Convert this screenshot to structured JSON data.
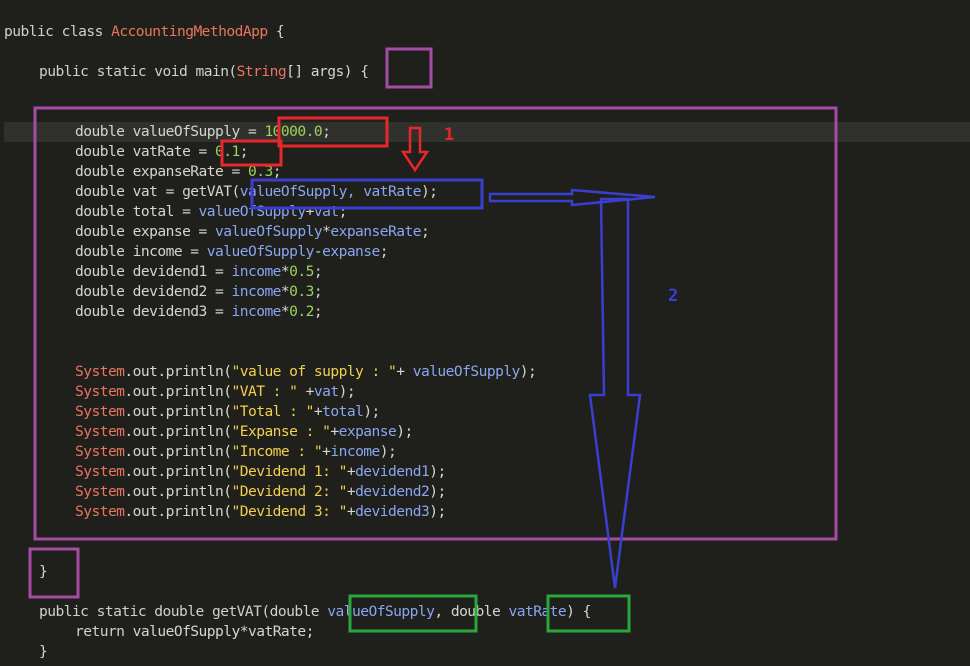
{
  "code": {
    "l1": [
      "public class ",
      "AccountingMethodApp",
      " {"
    ],
    "l2": [
      "public static void main(",
      "String",
      "[] args) {"
    ],
    "l3": [
      "double valueOfSupply = ",
      "10000.0",
      ";"
    ],
    "l4": [
      "double vatRate = ",
      "0.1",
      ";"
    ],
    "l5": [
      "double expanseRate = ",
      "0.3",
      ";"
    ],
    "l6": [
      "double vat = getVAT(",
      "valueOfSupply, vatRate",
      ");"
    ],
    "l7": [
      "double total = ",
      "valueOfSupply",
      "+",
      "vat",
      ";"
    ],
    "l8": [
      "double expanse = ",
      "valueOfSupply",
      "*",
      "expanseRate",
      ";"
    ],
    "l9": [
      "double income = ",
      "valueOfSupply",
      "-",
      "expanse",
      ";"
    ],
    "l10": [
      "double devidend1 = ",
      "income",
      "*",
      "0.5",
      ";"
    ],
    "l11": [
      "double devidend2 = ",
      "income",
      "*",
      "0.3",
      ";"
    ],
    "l12": [
      "double devidend3 = ",
      "income",
      "*",
      "0.2",
      ";"
    ],
    "p1": [
      "System",
      ".out.println(",
      "\"value of supply : \"",
      "+ ",
      "valueOfSupply",
      ");"
    ],
    "p2": [
      "System",
      ".out.println(",
      "\"VAT : \"",
      " +",
      "vat",
      ");"
    ],
    "p3": [
      "System",
      ".out.println(",
      "\"Total : \"",
      "+",
      "total",
      ");"
    ],
    "p4": [
      "System",
      ".out.println(",
      "\"Expanse : \"",
      "+",
      "expanse",
      ");"
    ],
    "p5": [
      "System",
      ".out.println(",
      "\"Income : \"",
      "+",
      "income",
      ");"
    ],
    "p6": [
      "System",
      ".out.println(",
      "\"Devidend 1: \"",
      "+",
      "devidend1",
      ");"
    ],
    "p7": [
      "System",
      ".out.println(",
      "\"Devidend 2: \"",
      "+",
      "devidend2",
      ");"
    ],
    "p8": [
      "System",
      ".out.println(",
      "\"Devidend 3: \"",
      "+",
      "devidend3",
      ");"
    ],
    "close_main": "}",
    "m1": [
      "public static double getVAT(double ",
      "valueOfSupply",
      ", double ",
      "vatRate",
      ") {"
    ],
    "m2": [
      "return ",
      "valueOfSupply",
      "*",
      "vatRate",
      ";"
    ],
    "m3": "}"
  },
  "annotations": {
    "label_1": "1",
    "label_2": "2",
    "colors": {
      "purple": "#a64ca6",
      "red": "#e8262b",
      "blue": "#3b3fd0",
      "green": "#2aa63a"
    }
  }
}
